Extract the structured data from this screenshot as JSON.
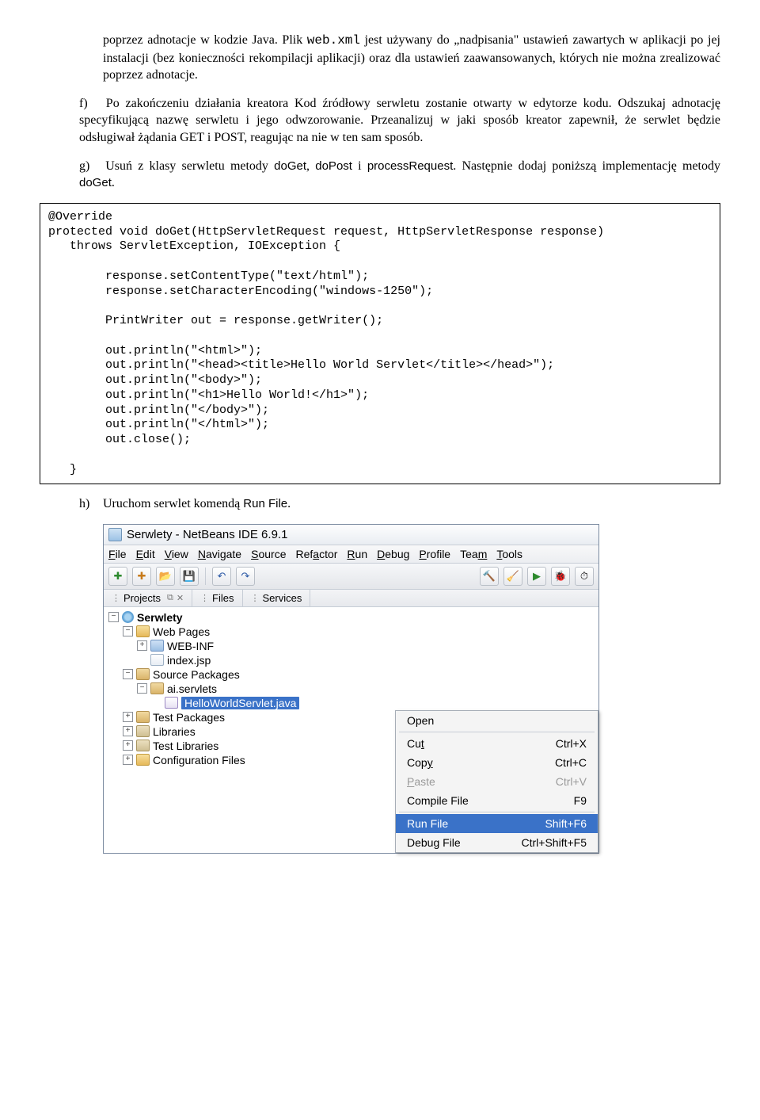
{
  "intro": {
    "p1a": "poprzez adnotacje w kodzie Java. Plik ",
    "p1code": "web.xml",
    "p1b": " jest używany do „nadpisania\" ustawień zawartych w aplikacji po jej instalacji (bez konieczności rekompilacji aplikacji) oraz dla ustawień zaawansowanych, których nie można zrealizować poprzez adnotacje."
  },
  "items": {
    "f": {
      "marker": "f)",
      "text": "Po zakończeniu działania kreatora Kod źródłowy serwletu zostanie otwarty w edytorze kodu. Odszukaj adnotację specyfikującą nazwę serwletu i jego odwzorowanie. Przeanalizuj w jaki sposób kreator zapewnił, że serwlet będzie odsługiwał żądania GET i POST, reagując na nie w ten sam sposób."
    },
    "g": {
      "marker": "g)",
      "t1": "Usuń z klasy serwletu metody ",
      "m1": "doGet",
      "t2": ", ",
      "m2": "doPost",
      "t3": " i ",
      "m3": "processRequest",
      "t4": ". Następnie dodaj poniższą implementację metody ",
      "m4": "doGet",
      "t5": "."
    },
    "h": {
      "marker": "h)",
      "t1": "Uruchom serwlet komendą ",
      "cmd": "Run File",
      "t2": "."
    }
  },
  "code": "@Override\nprotected void doGet(HttpServletRequest request, HttpServletResponse response)\n   throws ServletException, IOException {\n\n        response.setContentType(\"text/html\");\n        response.setCharacterEncoding(\"windows-1250\");\n\n        PrintWriter out = response.getWriter();\n\n        out.println(\"<html>\");\n        out.println(\"<head><title>Hello World Servlet</title></head>\");\n        out.println(\"<body>\");\n        out.println(\"<h1>Hello World!</h1>\");\n        out.println(\"</body>\");\n        out.println(\"</html>\");\n        out.close();\n\n   }",
  "ide": {
    "title": "Serwlety - NetBeans IDE 6.9.1",
    "menus": [
      "File",
      "Edit",
      "View",
      "Navigate",
      "Source",
      "Refactor",
      "Run",
      "Debug",
      "Profile",
      "Team",
      "Tools"
    ],
    "tabs": [
      "Projects",
      "Files",
      "Services"
    ],
    "tree": {
      "root": "Serwlety",
      "webpages": "Web Pages",
      "webinf": "WEB-INF",
      "indexjsp": "index.jsp",
      "srcpkg": "Source Packages",
      "pkg": "ai.servlets",
      "file": "HelloWorldServlet.java",
      "testpkg": "Test Packages",
      "libs": "Libraries",
      "testlibs": "Test Libraries",
      "conf": "Configuration Files"
    },
    "ctx": {
      "open": "Open",
      "cut": "Cut",
      "cut_k": "Ctrl+X",
      "copy": "Copy",
      "copy_k": "Ctrl+C",
      "paste": "Paste",
      "paste_k": "Ctrl+V",
      "compile": "Compile File",
      "compile_k": "F9",
      "run": "Run File",
      "run_k": "Shift+F6",
      "debug": "Debug File",
      "debug_k": "Ctrl+Shift+F5"
    }
  }
}
